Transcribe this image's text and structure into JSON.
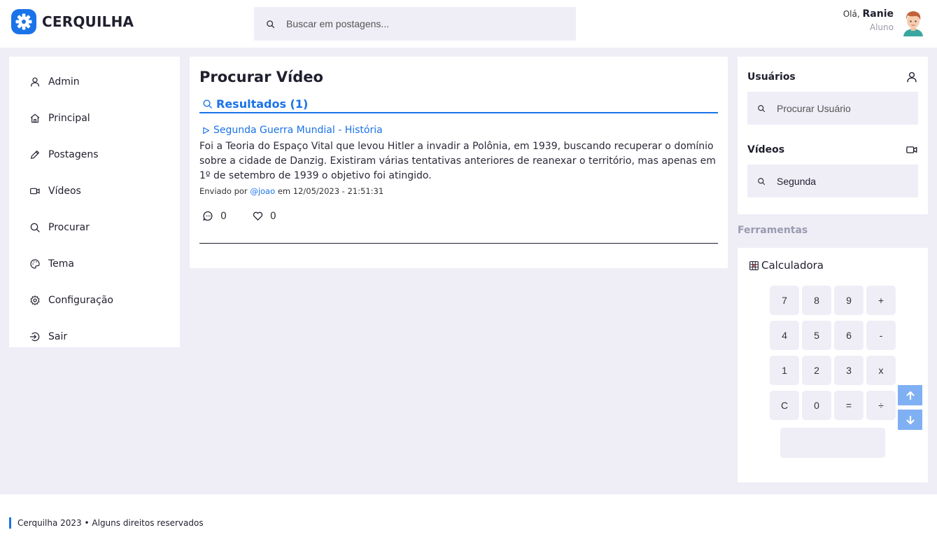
{
  "app": {
    "name": "CERQUILHA"
  },
  "header": {
    "search_placeholder": "Buscar em postagens...",
    "greeting": "Olá,",
    "user_name": "Ranie",
    "user_role": "Aluno"
  },
  "sidebar": {
    "items": [
      {
        "label": "Admin",
        "icon": "user-icon"
      },
      {
        "label": "Principal",
        "icon": "home-icon"
      },
      {
        "label": "Postagens",
        "icon": "pencil-icon"
      },
      {
        "label": "Vídeos",
        "icon": "video-icon"
      },
      {
        "label": "Procurar",
        "icon": "search-icon"
      },
      {
        "label": "Tema",
        "icon": "palette-icon"
      },
      {
        "label": "Configuração",
        "icon": "gear-icon"
      },
      {
        "label": "Sair",
        "icon": "logout-icon"
      }
    ]
  },
  "main": {
    "title": "Procurar Vídeo",
    "results_label": "Resultados (1)",
    "post": {
      "title": "Segunda Guerra Mundial - História",
      "body": "Foi a Teoria do Espaço Vital que levou Hitler a invadir a Polônia, em 1939, buscando recuperar o domínio sobre a cidade de Danzig. Existiram várias tentativas anteriores de reanexar o território, mas apenas em 1º de setembro de 1939 o objetivo foi atingido.",
      "sent_by": "Enviado por",
      "author": "@joao",
      "date_text": "em 12/05/2023 - 21:51:31",
      "comments": "0",
      "likes": "0"
    }
  },
  "right": {
    "users_label": "Usuários",
    "users_placeholder": "Procurar Usuário",
    "videos_label": "Vídeos",
    "videos_value": "Segunda",
    "tools_label": "Ferramentas",
    "calculator_label": "Calculadora",
    "calculator_keys": [
      "7",
      "8",
      "9",
      "+",
      "4",
      "5",
      "6",
      "-",
      "1",
      "2",
      "3",
      "x",
      "C",
      "0",
      "=",
      "÷"
    ]
  },
  "footer": {
    "text": "Cerquilha 2023 • Alguns direitos reservados"
  },
  "colors": {
    "accent": "#1a73e8",
    "background": "#efeef7",
    "scroll_button": "#7fb0f3"
  }
}
